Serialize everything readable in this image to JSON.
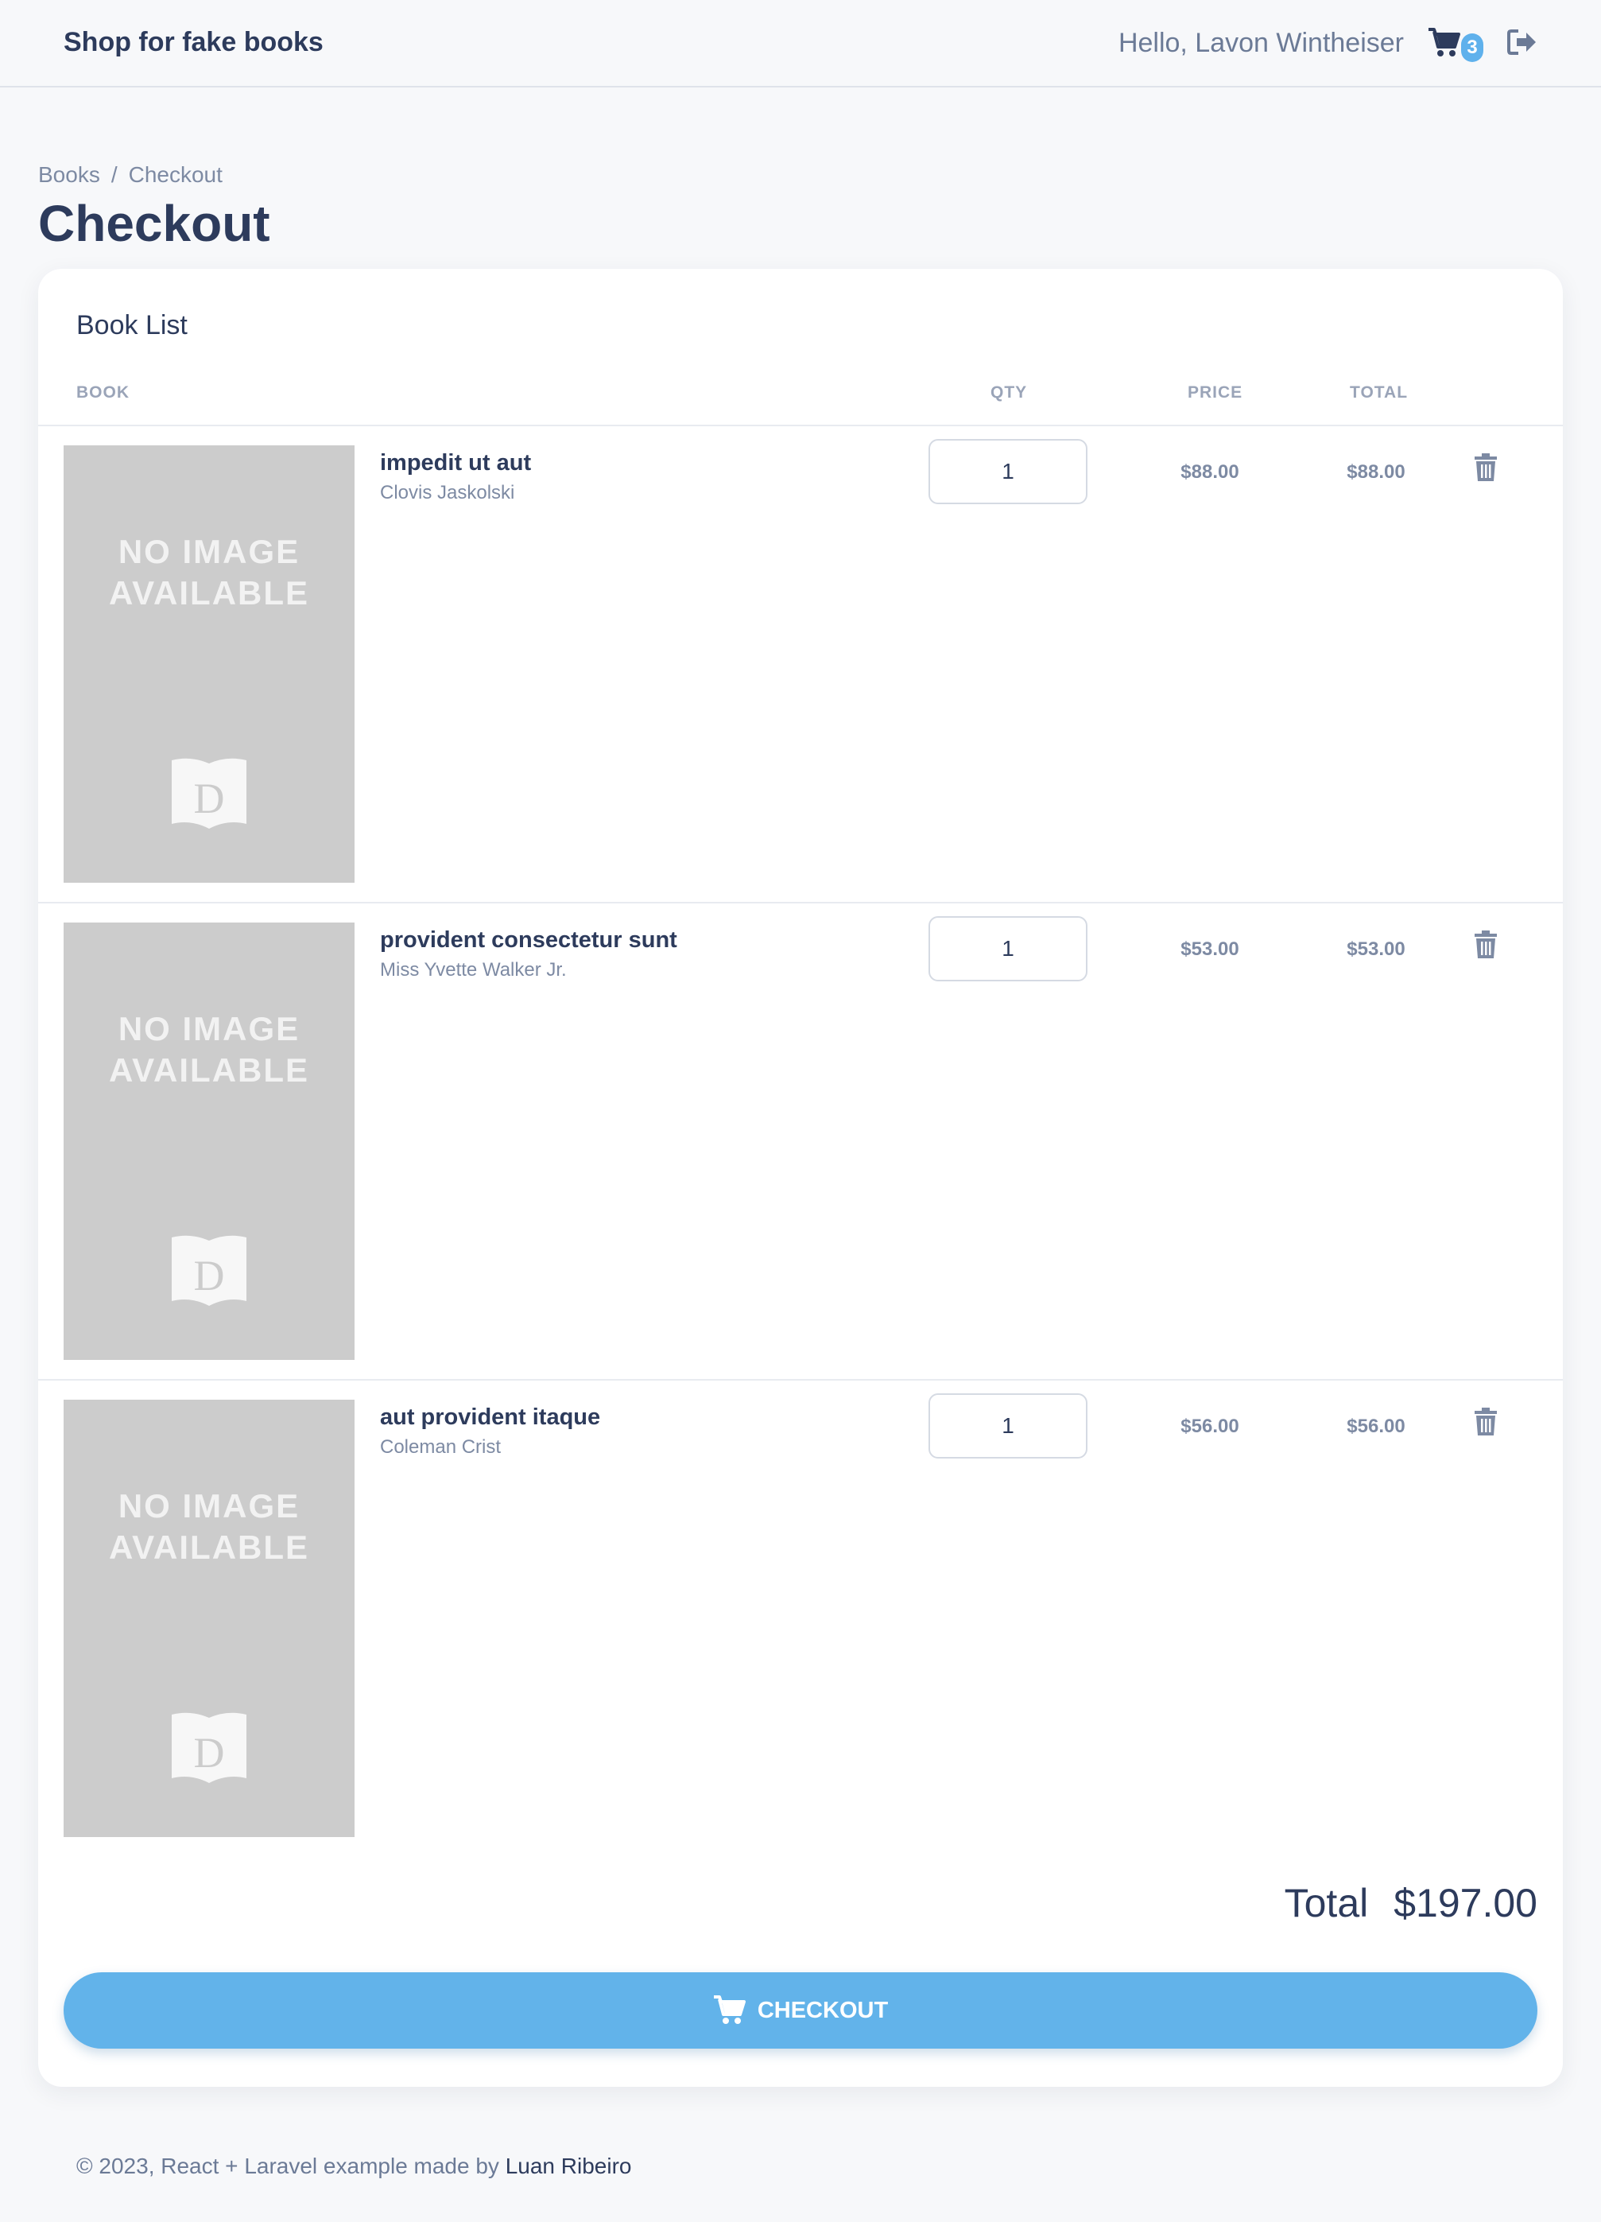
{
  "header": {
    "brand": "Shop for fake books",
    "greeting": "Hello, Lavon Wintheiser",
    "cart_count": "3",
    "icons": [
      "shopping-cart-icon",
      "logout-icon"
    ]
  },
  "breadcrumb": {
    "items": [
      "Books",
      "Checkout"
    ],
    "separator": "/"
  },
  "page": {
    "title": "Checkout"
  },
  "book_list": {
    "title": "Book List",
    "columns": [
      "BOOK",
      "QTY",
      "PRICE",
      "TOTAL"
    ],
    "placeholder_image_text": [
      "NO IMAGE",
      "AVAILABLE"
    ],
    "items": [
      {
        "title": "impedit ut aut",
        "author": "Clovis Jaskolski",
        "qty": "1",
        "price": "$88.00",
        "total": "$88.00"
      },
      {
        "title": "provident consectetur sunt",
        "author": "Miss Yvette Walker Jr.",
        "qty": "1",
        "price": "$53.00",
        "total": "$53.00"
      },
      {
        "title": "aut provident itaque",
        "author": "Coleman Crist",
        "qty": "1",
        "price": "$56.00",
        "total": "$56.00"
      }
    ],
    "total_label": "Total",
    "total_value": "$197.00",
    "checkout_label": "CHECKOUT"
  },
  "footer": {
    "text": "© 2023, React + Laravel example made by",
    "author_link": "Luan Ribeiro"
  },
  "colors": {
    "primary_text": "#2d3b5c",
    "muted_text": "#7d8aa3",
    "accent": "#62b3ea",
    "background": "#f7f8fa"
  }
}
